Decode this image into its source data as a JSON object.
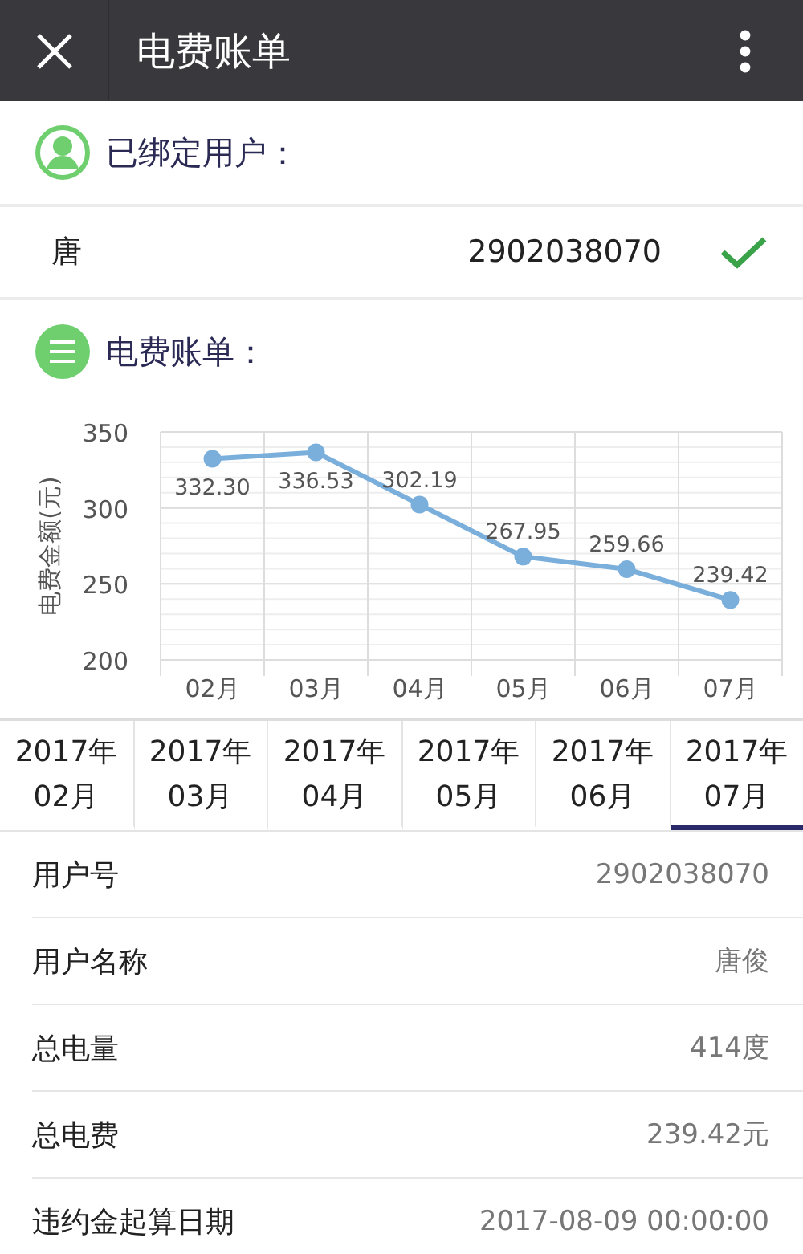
{
  "window": {
    "title": "电费账单"
  },
  "bound_section": {
    "title": "已绑定用户："
  },
  "bound_user": {
    "name": "唐",
    "account": "2902038070",
    "checked": true
  },
  "bill_section": {
    "title": "电费账单："
  },
  "chart": {
    "chart_data": {
      "type": "line",
      "ylabel": "电费金额(元)",
      "categories": [
        "02月",
        "03月",
        "04月",
        "05月",
        "06月",
        "07月"
      ],
      "series": [
        {
          "color": "#7aaedb",
          "marker": "circle",
          "values": [
            332.3,
            336.53,
            302.19,
            267.95,
            259.66,
            239.42
          ]
        }
      ],
      "ylim": [
        200,
        350
      ],
      "yticks": [
        200,
        250,
        300,
        350
      ],
      "value_labels": [
        "332.30",
        "336.53",
        "302.19",
        "267.95",
        "259.66",
        "239.42"
      ]
    }
  },
  "tabs": [
    {
      "year": "2017年",
      "month": "02月",
      "selected": false
    },
    {
      "year": "2017年",
      "month": "03月",
      "selected": false
    },
    {
      "year": "2017年",
      "month": "04月",
      "selected": false
    },
    {
      "year": "2017年",
      "month": "05月",
      "selected": false
    },
    {
      "year": "2017年",
      "month": "06月",
      "selected": false
    },
    {
      "year": "2017年",
      "month": "07月",
      "selected": true
    }
  ],
  "details": [
    {
      "label": "用户号",
      "value": "2902038070"
    },
    {
      "label": "用户名称",
      "value": "唐俊"
    },
    {
      "label": "总电量",
      "value": "414度"
    },
    {
      "label": "总电费",
      "value": "239.42元"
    },
    {
      "label": "违约金起算日期",
      "value": "2017-08-09 00:00:00"
    }
  ]
}
